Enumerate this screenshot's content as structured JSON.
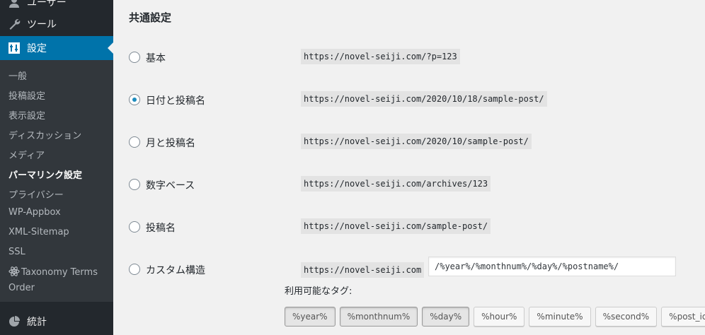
{
  "sidebar": {
    "users_label": "ユーザー",
    "tools_label": "ツール",
    "settings_label": "設定",
    "submenu": [
      {
        "label": "一般"
      },
      {
        "label": "投稿設定"
      },
      {
        "label": "表示設定"
      },
      {
        "label": "ディスカッション"
      },
      {
        "label": "メディア"
      },
      {
        "label": "パーマリンク設定"
      },
      {
        "label": "プライバシー"
      },
      {
        "label": "WP-Appbox"
      },
      {
        "label": "XML-Sitemap"
      },
      {
        "label": "SSL"
      },
      {
        "label": "Taxonomy Terms Order"
      }
    ],
    "stats_label": "統計"
  },
  "main": {
    "section_title": "共通設定",
    "options": [
      {
        "label": "基本",
        "url": "https://novel-seiji.com/?p=123",
        "checked": false
      },
      {
        "label": "日付と投稿名",
        "url": "https://novel-seiji.com/2020/10/18/sample-post/",
        "checked": true
      },
      {
        "label": "月と投稿名",
        "url": "https://novel-seiji.com/2020/10/sample-post/",
        "checked": false
      },
      {
        "label": "数字ベース",
        "url": "https://novel-seiji.com/archives/123",
        "checked": false
      },
      {
        "label": "投稿名",
        "url": "https://novel-seiji.com/sample-post/",
        "checked": false
      },
      {
        "label": "カスタム構造",
        "url": "https://novel-seiji.com",
        "checked": false
      }
    ],
    "custom_structure_value": "/%year%/%monthnum%/%day%/%postname%/",
    "available_tags_label": "利用可能なタグ:",
    "tags": [
      "%year%",
      "%monthnum%",
      "%day%",
      "%hour%",
      "%minute%",
      "%second%",
      "%post_id%"
    ],
    "active_tags": [
      "%year%",
      "%monthnum%",
      "%day%"
    ]
  },
  "colors": {
    "sidebar_bg": "#23282d",
    "submenu_bg": "#32373c",
    "accent": "#0073aa",
    "radio_checked": "#1e8cbe"
  }
}
